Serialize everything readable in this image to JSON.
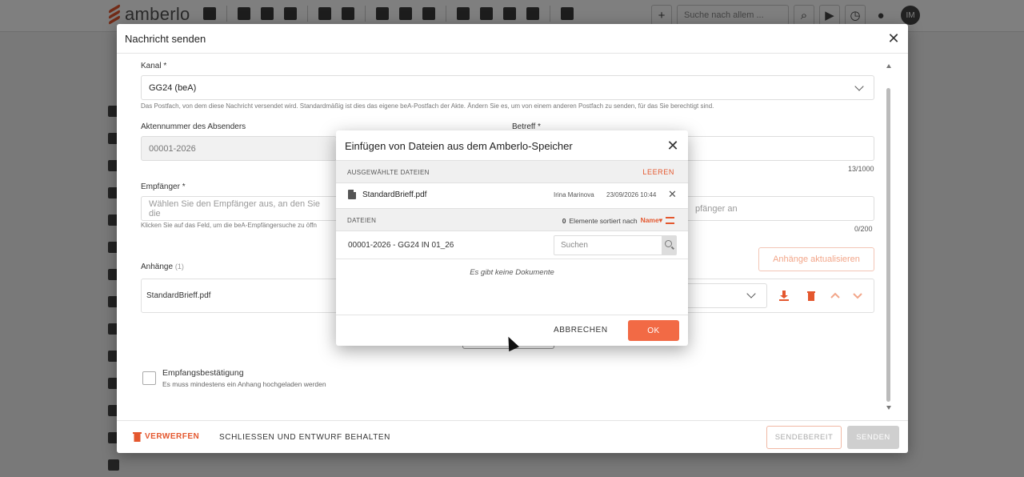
{
  "app": {
    "logo_text": "amberlo",
    "search_placeholder": "Suche nach allem ...",
    "avatar_initials": "IM",
    "accent_color": "#e4572e"
  },
  "modal": {
    "title": "Nachricht senden",
    "channel": {
      "label": "Kanal *",
      "value": "GG24 (beA)",
      "help": "Das Postfach, von dem diese Nachricht versendet wird. Standardmäßig ist dies das eigene beA-Postfach der Akte. Ändern Sie es, um von einem anderen Postfach zu senden, für das Sie berechtigt sind."
    },
    "sender_ref": {
      "label": "Aktennummer des Absenders",
      "value": "00001-2026"
    },
    "subject": {
      "label": "Betreff *",
      "counter": "13/1000"
    },
    "recipient": {
      "label": "Empfänger *",
      "placeholder_left": "Wählen Sie den Empfänger aus, an den Sie die",
      "placeholder_right": "pfänger an",
      "help": "Klicken Sie auf das Feld, um die beA-Empfängersuche zu öffn",
      "counter": "0/200"
    },
    "attachments": {
      "label": "Anhänge",
      "count": "(1)",
      "update_button": "Anhänge aktualisieren",
      "items": [
        {
          "name": "StandardBrieff.pdf"
        }
      ]
    },
    "confirmation": {
      "label": "Empfangsbestätigung",
      "sub": "Es muss mindestens ein Anhang hochgeladen werden"
    },
    "footer": {
      "discard": "VERWERFEN",
      "keep_draft": "SCHLIESSEN UND ENTWURF BEHALTEN",
      "ready": "SENDEBEREIT",
      "send": "SENDEN"
    }
  },
  "dialog": {
    "title": "Einfügen von Dateien aus dem Amberlo-Speicher",
    "selected_header": "AUSGEWÄHLTE DATEIEN",
    "clear": "LEEREN",
    "selected_files": [
      {
        "name": "StandardBrieff.pdf",
        "user": "Irina Marinova",
        "date": "23/09/2026 10:44"
      }
    ],
    "files_header": "DATEIEN",
    "sort": {
      "count": "0",
      "text": "Elemente sortiert nach",
      "field": "Name"
    },
    "path": "00001-2026 - GG24 IN 01_26",
    "search_placeholder": "Suchen",
    "empty": "Es gibt keine Dokumente",
    "cancel": "ABBRECHEN",
    "ok": "OK"
  }
}
